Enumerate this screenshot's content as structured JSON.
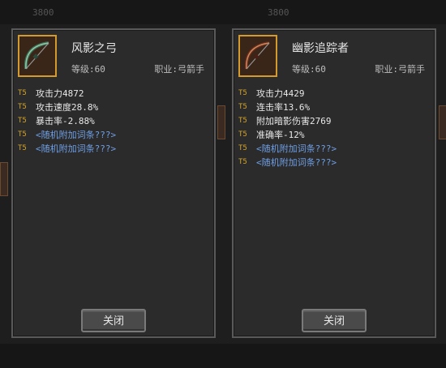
{
  "background": {
    "top_bar": [
      "3800",
      "3800"
    ]
  },
  "items": [
    {
      "name": "风影之弓",
      "level_label": "等级:",
      "level_value": "60",
      "job_label": "职业:",
      "job_value": "弓箭手",
      "icon": "bow-icon",
      "stats": [
        {
          "tier": "T5",
          "text": "攻击力4872",
          "random": false
        },
        {
          "tier": "T5",
          "text": "攻击速度28.8%",
          "random": false
        },
        {
          "tier": "T5",
          "text": "暴击率-2.88%",
          "random": false
        },
        {
          "tier": "T5",
          "text": "<随机附加词条???>",
          "random": true
        },
        {
          "tier": "T5",
          "text": "<随机附加词条???>",
          "random": true
        }
      ],
      "close_label": "关闭"
    },
    {
      "name": "幽影追踪者",
      "level_label": "等级:",
      "level_value": "60",
      "job_label": "职业:",
      "job_value": "弓箭手",
      "icon": "bow-icon",
      "stats": [
        {
          "tier": "T5",
          "text": "攻击力4429",
          "random": false
        },
        {
          "tier": "T5",
          "text": "连击率13.6%",
          "random": false
        },
        {
          "tier": "T5",
          "text": "附加暗影伤害2769",
          "random": false
        },
        {
          "tier": "T5",
          "text": "准确率-12%",
          "random": false
        },
        {
          "tier": "T5",
          "text": "<随机附加词条???>",
          "random": true
        },
        {
          "tier": "T5",
          "text": "<随机附加词条???>",
          "random": true
        }
      ],
      "close_label": "关闭"
    }
  ],
  "colors": {
    "tier": "#d4a42a",
    "random_stat": "#6f9fe6",
    "slot_border": "#d49a2e"
  }
}
